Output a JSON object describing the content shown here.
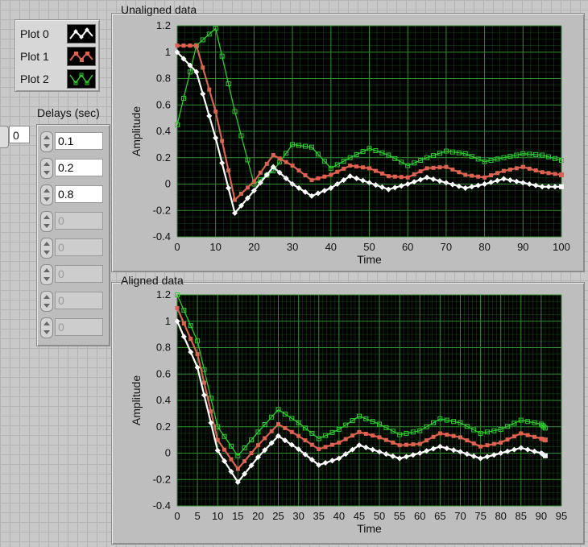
{
  "legend": {
    "items": [
      {
        "label": "Plot 0",
        "color": "#ffffff"
      },
      {
        "label": "Plot 1",
        "color": "#e0614e"
      },
      {
        "label": "Plot 2",
        "color": "#2ad12a"
      }
    ]
  },
  "index_value": "0",
  "delays": {
    "title": "Delays (sec)",
    "values": [
      "0.1",
      "0.2",
      "0.8",
      "0",
      "0",
      "0",
      "0",
      "0"
    ]
  },
  "colors": {
    "plot_bg": "#000000",
    "grid": "#1f6a1f",
    "plot0": "#ffffff",
    "plot1": "#e0614e",
    "plot2": "#2ad12a"
  },
  "chart_data": [
    {
      "type": "line",
      "title": "Unaligned data",
      "xlabel": "Time",
      "ylabel": "Amplitude",
      "xlim": [
        0,
        100
      ],
      "ylim": [
        -0.4,
        1.2
      ],
      "xticks": [
        "0",
        "10",
        "20",
        "30",
        "40",
        "50",
        "60",
        "70",
        "80",
        "90",
        "100"
      ],
      "yticks": [
        "1.2",
        "1",
        "0.8",
        "0.6",
        "0.4",
        "0.2",
        "0",
        "-0.2",
        "-0.4"
      ],
      "series": [
        {
          "name": "Plot 0",
          "x": [
            0,
            5,
            10,
            15,
            20,
            25,
            30,
            35,
            40,
            45,
            50,
            55,
            60,
            65,
            70,
            75,
            80,
            85,
            90,
            95,
            100
          ],
          "y": [
            1.0,
            0.85,
            0.35,
            -0.22,
            -0.05,
            0.13,
            0.0,
            -0.09,
            -0.03,
            0.06,
            0.01,
            -0.04,
            0.0,
            0.05,
            0.01,
            -0.03,
            0.0,
            0.04,
            0.01,
            -0.02,
            -0.02
          ]
        },
        {
          "name": "Plot 1",
          "x": [
            0,
            5,
            10,
            15,
            20,
            25,
            30,
            35,
            40,
            45,
            50,
            55,
            60,
            65,
            70,
            75,
            80,
            85,
            90,
            95,
            100
          ],
          "y": [
            1.05,
            1.05,
            0.55,
            -0.12,
            0.02,
            0.22,
            0.14,
            0.03,
            0.07,
            0.14,
            0.12,
            0.06,
            0.05,
            0.12,
            0.13,
            0.07,
            0.05,
            0.1,
            0.13,
            0.09,
            0.07
          ]
        },
        {
          "name": "Plot 2",
          "x": [
            0,
            5,
            10,
            15,
            20,
            25,
            30,
            35,
            40,
            45,
            50,
            55,
            60,
            65,
            70,
            75,
            80,
            85,
            90,
            95,
            100
          ],
          "y": [
            0.45,
            1.05,
            1.18,
            0.55,
            0.0,
            0.1,
            0.3,
            0.28,
            0.12,
            0.2,
            0.27,
            0.22,
            0.14,
            0.2,
            0.25,
            0.23,
            0.17,
            0.2,
            0.23,
            0.22,
            0.18
          ]
        }
      ]
    },
    {
      "type": "line",
      "title": "Aligned data",
      "xlabel": "Time",
      "ylabel": "Amplitude",
      "xlim": [
        0,
        95
      ],
      "ylim": [
        -0.4,
        1.2
      ],
      "xticks": [
        "0",
        "5",
        "10",
        "15",
        "20",
        "25",
        "30",
        "35",
        "40",
        "45",
        "50",
        "55",
        "60",
        "65",
        "70",
        "75",
        "80",
        "85",
        "90",
        "95"
      ],
      "yticks": [
        "1.2",
        "1",
        "0.8",
        "0.6",
        "0.4",
        "0.2",
        "0",
        "-0.2",
        "-0.4"
      ],
      "series": [
        {
          "name": "Plot 0",
          "x": [
            0,
            5,
            10,
            15,
            20,
            25,
            30,
            35,
            40,
            45,
            50,
            55,
            60,
            65,
            70,
            75,
            80,
            85,
            90,
            91
          ],
          "y": [
            1.0,
            0.65,
            0.02,
            -0.22,
            -0.03,
            0.13,
            0.03,
            -0.09,
            -0.04,
            0.06,
            0.01,
            -0.04,
            0.0,
            0.05,
            0.01,
            -0.04,
            0.0,
            0.04,
            0.0,
            -0.02
          ]
        },
        {
          "name": "Plot 1",
          "x": [
            0,
            5,
            10,
            15,
            20,
            25,
            30,
            35,
            40,
            45,
            50,
            55,
            60,
            65,
            70,
            75,
            80,
            85,
            90,
            91
          ],
          "y": [
            1.1,
            0.75,
            0.1,
            -0.12,
            0.06,
            0.22,
            0.13,
            0.03,
            0.08,
            0.16,
            0.12,
            0.06,
            0.07,
            0.15,
            0.12,
            0.05,
            0.08,
            0.15,
            0.11,
            0.1
          ]
        },
        {
          "name": "Plot 2",
          "x": [
            0,
            5,
            10,
            15,
            20,
            25,
            30,
            35,
            40,
            45,
            50,
            55,
            60,
            65,
            70,
            75,
            80,
            85,
            90,
            91
          ],
          "y": [
            1.2,
            0.85,
            0.2,
            -0.02,
            0.16,
            0.33,
            0.23,
            0.11,
            0.18,
            0.28,
            0.22,
            0.14,
            0.17,
            0.26,
            0.23,
            0.15,
            0.18,
            0.25,
            0.22,
            0.19
          ]
        }
      ]
    }
  ]
}
